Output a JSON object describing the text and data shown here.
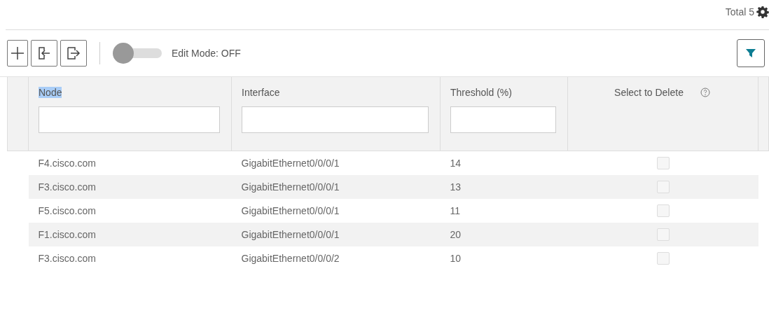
{
  "total": "Total 5",
  "toolbar": {
    "edit_mode": {
      "label": "Edit Mode: OFF",
      "on": false
    }
  },
  "table": {
    "columns": [
      {
        "label": "Node",
        "highlighted": true,
        "filter": true,
        "help": false
      },
      {
        "label": "Interface",
        "highlighted": false,
        "filter": true,
        "help": false
      },
      {
        "label": "Threshold (%)",
        "highlighted": false,
        "filter": true,
        "help": false
      },
      {
        "label": "Select to Delete",
        "highlighted": false,
        "filter": false,
        "help": true
      }
    ],
    "rows": [
      {
        "node": "F4.cisco.com",
        "interface": "GigabitEthernet0/0/0/1",
        "threshold": "14",
        "checked": false,
        "disabled": true
      },
      {
        "node": "F3.cisco.com",
        "interface": "GigabitEthernet0/0/0/1",
        "threshold": "13",
        "checked": false,
        "disabled": true
      },
      {
        "node": "F5.cisco.com",
        "interface": "GigabitEthernet0/0/0/1",
        "threshold": "11",
        "checked": false,
        "disabled": true
      },
      {
        "node": "F1.cisco.com",
        "interface": "GigabitEthernet0/0/0/1",
        "threshold": "20",
        "checked": false,
        "disabled": true
      },
      {
        "node": "F3.cisco.com",
        "interface": "GigabitEthernet0/0/0/2",
        "threshold": "10",
        "checked": false,
        "disabled": true
      }
    ]
  }
}
